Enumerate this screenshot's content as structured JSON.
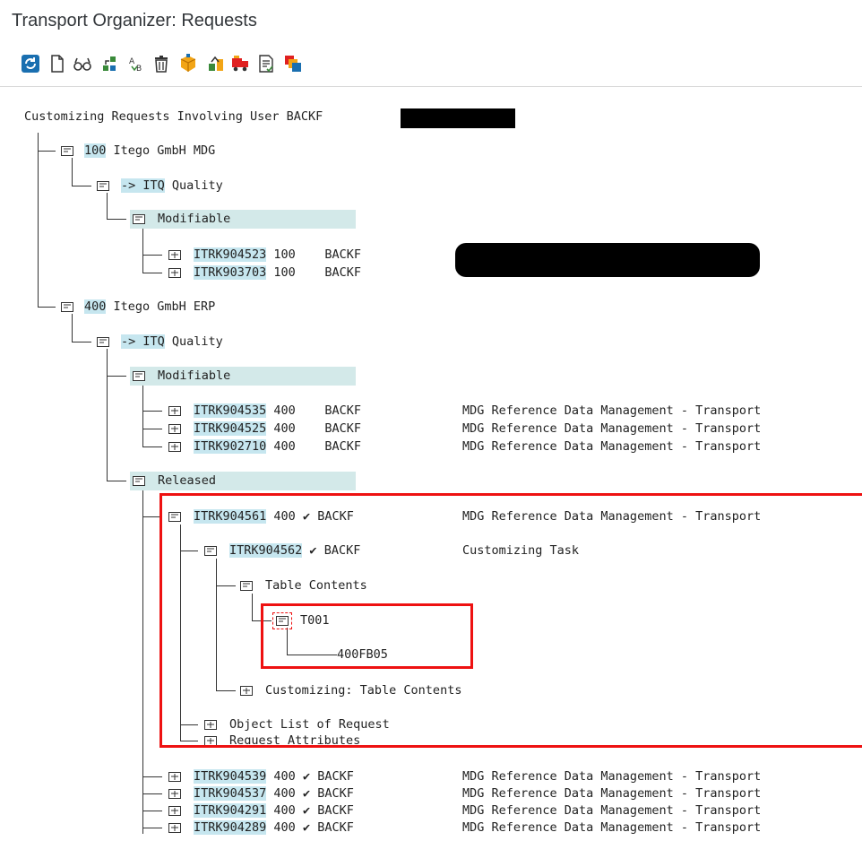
{
  "window": {
    "title": "Transport Organizer: Requests"
  },
  "toolbar": {
    "buttons": [
      {
        "icon": "refresh-icon"
      },
      {
        "icon": "new-document-icon"
      },
      {
        "icon": "display-glasses-icon"
      },
      {
        "icon": "change-icon"
      },
      {
        "icon": "sort-ab-icon"
      },
      {
        "icon": "delete-trash-icon"
      },
      {
        "icon": "lock-package-icon"
      },
      {
        "icon": "release-icon"
      },
      {
        "icon": "transport-truck-icon"
      },
      {
        "icon": "document-check-icon"
      },
      {
        "icon": "copy-layers-icon"
      }
    ]
  },
  "tree": {
    "root_label": "Customizing Requests Involving User BACKF",
    "client100": {
      "num": "100",
      "name": " Itego GmbH MDG"
    },
    "client100_target": {
      "arrow": "-> ITQ",
      "label": " Quality"
    },
    "client100_modifiable": "Modifiable",
    "client100_requests": [
      {
        "id": "ITRK904523",
        "client": "100",
        "owner": "BACKF"
      },
      {
        "id": "ITRK903703",
        "client": "100",
        "owner": "BACKF"
      }
    ],
    "client400": {
      "num": "400",
      "name": " Itego GmbH ERP"
    },
    "client400_target": {
      "arrow": "-> ITQ",
      "label": " Quality"
    },
    "client400_modifiable": "Modifiable",
    "client400_mod_requests": [
      {
        "id": "ITRK904535",
        "client": "400",
        "owner": "BACKF",
        "desc": "MDG Reference Data Management - Transport"
      },
      {
        "id": "ITRK904525",
        "client": "400",
        "owner": "BACKF",
        "desc": "MDG Reference Data Management - Transport"
      },
      {
        "id": "ITRK902710",
        "client": "400",
        "owner": "BACKF",
        "desc": "MDG Reference Data Management - Transport"
      }
    ],
    "released": "Released",
    "released_main": {
      "id": "ITRK904561",
      "client": "400",
      "check": "✔",
      "owner": "BACKF",
      "desc": "MDG Reference Data Management - Transport"
    },
    "task": {
      "id": "ITRK904562",
      "check": "✔",
      "owner": "BACKF",
      "desc": "Customizing Task"
    },
    "table_contents": "Table Contents",
    "table_name": "T001",
    "table_key": "400FB05",
    "customizing_table_contents": "Customizing: Table Contents",
    "object_list": "Object List of Request",
    "request_attributes": "Request Attributes",
    "released_requests": [
      {
        "id": "ITRK904539",
        "client": "400",
        "check": "✔",
        "owner": "BACKF",
        "desc": "MDG Reference Data Management - Transport"
      },
      {
        "id": "ITRK904537",
        "client": "400",
        "check": "✔",
        "owner": "BACKF",
        "desc": "MDG Reference Data Management - Transport"
      },
      {
        "id": "ITRK904291",
        "client": "400",
        "check": "✔",
        "owner": "BACKF",
        "desc": "MDG Reference Data Management - Transport"
      },
      {
        "id": "ITRK904289",
        "client": "400",
        "check": "✔",
        "owner": "BACKF",
        "desc": "MDG Reference Data Management - Transport"
      }
    ]
  },
  "colors": {
    "highlight": "#c6e6ef",
    "band": "#d3e9e9",
    "annotation": "#ee1111"
  }
}
